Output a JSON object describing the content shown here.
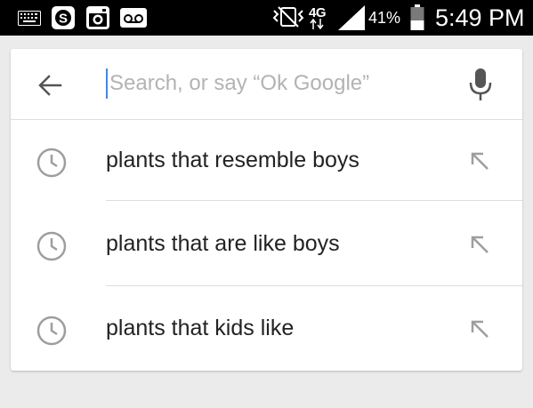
{
  "status_bar": {
    "network": "4G",
    "battery_percent": "41%",
    "time": "5:49 PM",
    "icons": [
      "keyboard-icon",
      "skype-icon",
      "instagram-icon",
      "voicemail-icon",
      "vibrate-icon",
      "signal-icon",
      "battery-icon"
    ]
  },
  "search": {
    "placeholder": "Search, or say “Ok Google”",
    "value": ""
  },
  "suggestions": [
    {
      "text": "plants that resemble boys"
    },
    {
      "text": "plants that are like boys"
    },
    {
      "text": "plants that kids like"
    }
  ],
  "colors": {
    "accent": "#4285f4",
    "status_bar_bg": "#000000",
    "icon_gray": "#9e9e9e"
  }
}
